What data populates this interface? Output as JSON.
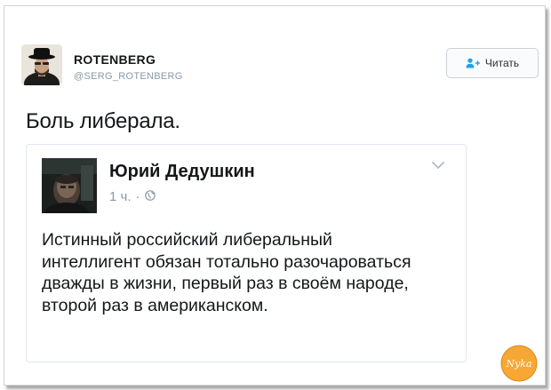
{
  "tweet": {
    "author": {
      "name": "ROTENBERG",
      "handle": "@SERG_ROTENBERG"
    },
    "follow_button": {
      "icon": "add-user-icon",
      "label": "Читать"
    },
    "text": "Боль либерала."
  },
  "quoted_post": {
    "author_name": "Юрий Дедушкин",
    "time": "1 ч.",
    "separator": "·",
    "privacy_icon": "globe-icon",
    "menu_icon": "chevron-down-icon",
    "text": "Истинный российский либеральный интеллигент обязан тотально разочароваться дважды в жизни, первый раз в своём народе, второй раз в американском."
  },
  "watermark": {
    "text": "Nyka",
    "color": "#f7a733"
  },
  "colors": {
    "accent": "#1da1f2",
    "muted": "#8899a6",
    "text": "#14171a"
  }
}
